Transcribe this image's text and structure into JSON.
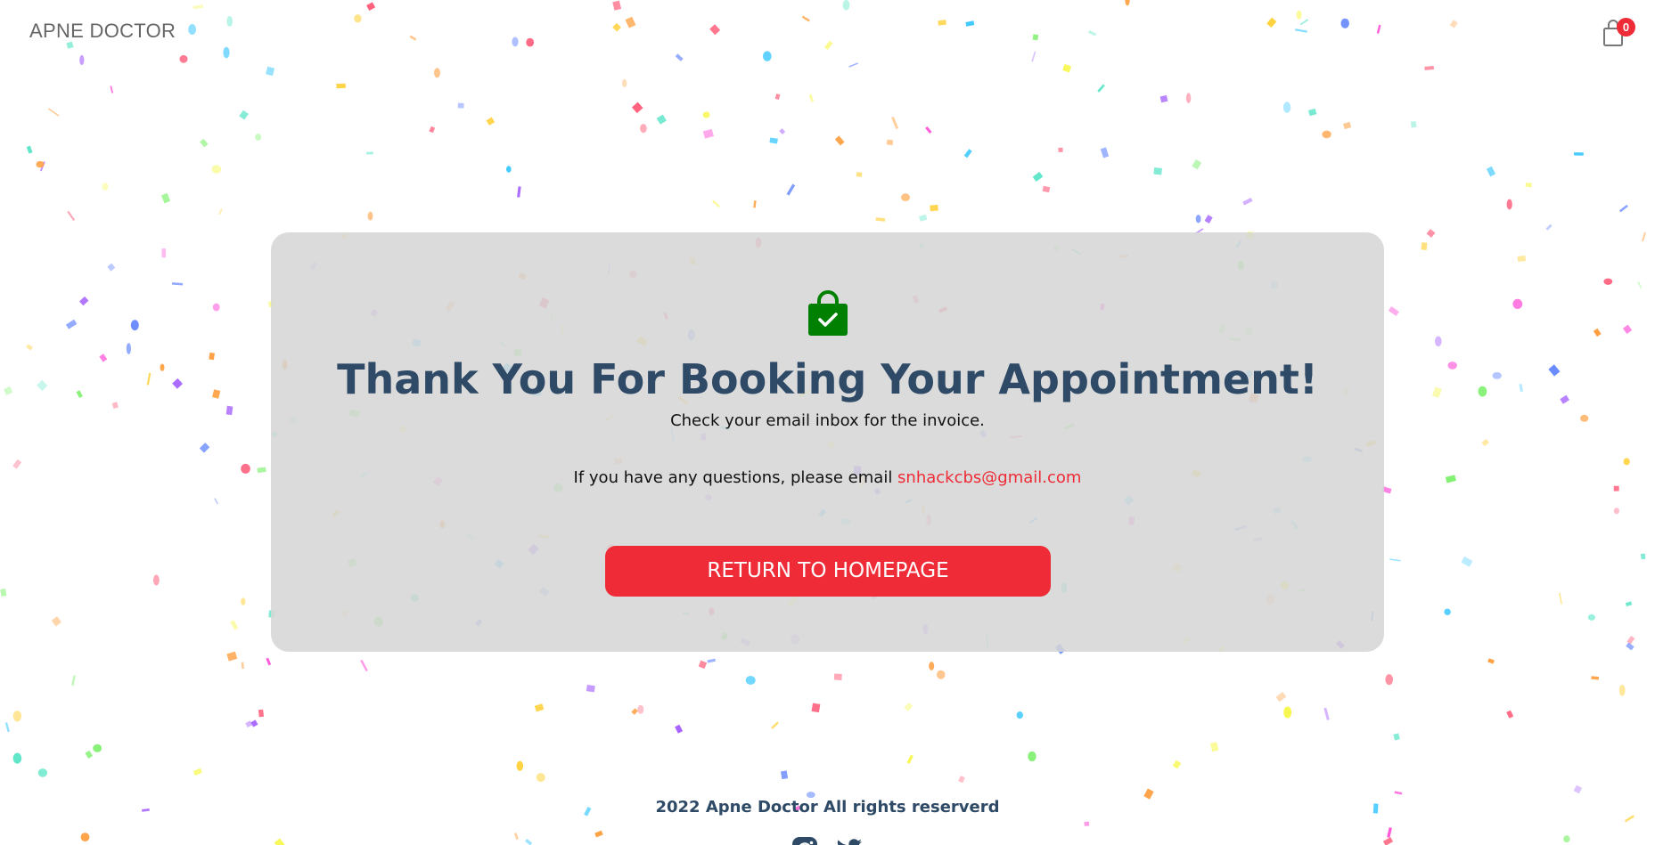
{
  "navbar": {
    "brand": "APNE DOCTOR",
    "cart_count": "0",
    "cart_icon": "shopping-bag-icon"
  },
  "success": {
    "icon": "bag-check-icon",
    "title": "Thank You For Booking Your Appointment!",
    "subtitle": "Check your email inbox for the invoice.",
    "question_text": "If you have any questions, please email ",
    "email": "snhackcbs@gmail.com",
    "button_label": "RETURN TO HOMEPAGE"
  },
  "footer": {
    "copyright": "2022 Apne Doctor All rights reserverd",
    "social": [
      {
        "icon": "instagram-icon"
      },
      {
        "icon": "twitter-icon"
      }
    ]
  },
  "colors": {
    "accent": "#ee2b36",
    "title": "#2e4a66",
    "card": "#d9d9d9",
    "bag": "#008000"
  }
}
